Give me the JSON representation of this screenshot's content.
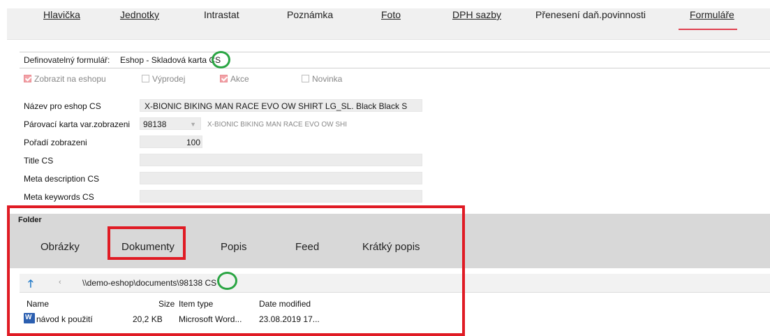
{
  "top_tabs": [
    {
      "label": "Hlavička"
    },
    {
      "label": "Jednotky"
    },
    {
      "label": "Intrastat"
    },
    {
      "label": "Poznámka"
    },
    {
      "label": "Foto"
    },
    {
      "label": "DPH sazby"
    },
    {
      "label": "Přenesení daň.povinnosti"
    },
    {
      "label": "Formuláře"
    }
  ],
  "active_tab": "Formuláře",
  "form": {
    "def_label": "Definovatelný formulář:",
    "def_value": "Eshop - Skladová karta",
    "def_suffix": "CS",
    "checkboxes": [
      {
        "label": "Zobrazit na eshopu",
        "checked": true
      },
      {
        "label": "Výprodej",
        "checked": false
      },
      {
        "label": "Akce",
        "checked": true
      },
      {
        "label": "Novinka",
        "checked": false
      }
    ],
    "rows": [
      {
        "label": "Název pro eshop CS",
        "value": "X-BIONIC BIKING MAN RACE EVO OW SHIRT LG_SL. Black Black S"
      },
      {
        "label": "Párovací karta var.zobrazeni",
        "value": "98138",
        "extra": "X-BIONIC BIKING MAN RACE EVO OW SHI"
      },
      {
        "label": "Pořadí zobrazeni",
        "value": "100"
      },
      {
        "label": "Title CS",
        "value": ""
      },
      {
        "label": "Meta description CS",
        "value": ""
      },
      {
        "label": "Meta keywords CS",
        "value": ""
      }
    ]
  },
  "folder": {
    "title": "Folder",
    "tabs": [
      {
        "label": "Obrázky"
      },
      {
        "label": "Dokumenty"
      },
      {
        "label": "Popis"
      },
      {
        "label": "Feed"
      },
      {
        "label": "Krátký popis"
      }
    ],
    "active_tab": "Dokumenty",
    "path": "\\\\demo-eshop\\documents\\98138",
    "path_suffix": "CS",
    "columns": {
      "name": "Name",
      "size": "Size",
      "type": "Item type",
      "date": "Date modified"
    },
    "files": [
      {
        "name": "návod k použití",
        "size": "20,2 KB",
        "type": "Microsoft Word...",
        "date": "23.08.2019 17..."
      }
    ]
  },
  "colors": {
    "highlight_red": "#e01b24",
    "highlight_green": "#2aa543",
    "active_underline": "#e0404f",
    "nav_arrow": "#1e78c8"
  }
}
